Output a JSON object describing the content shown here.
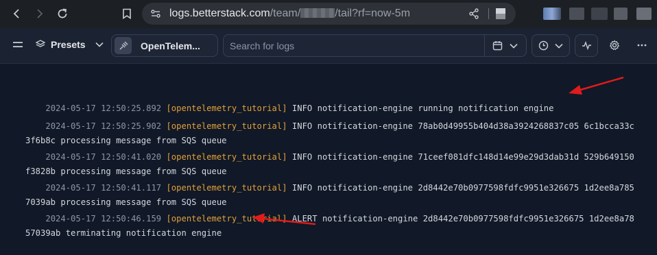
{
  "browser": {
    "url_host": "logs.betterstack.com",
    "url_path_prefix": "/team/",
    "url_path_suffix": "/tail?rf=now-5m"
  },
  "toolbar": {
    "presets_label": "Presets",
    "source_label": "OpenTelem...",
    "search_placeholder": "Search for logs"
  },
  "logs": [
    {
      "timestamp": "2024-05-17 12:50:25.892",
      "source": "[opentelemetry_tutorial]",
      "message": "INFO notification-engine running notification engine"
    },
    {
      "timestamp": "2024-05-17 12:50:25.902",
      "source": "[opentelemetry_tutorial]",
      "message": "INFO notification-engine 78ab0d49955b404d38a3924268837c05 6c1bcca33c3f6b8c processing message from SQS queue"
    },
    {
      "timestamp": "2024-05-17 12:50:41.020",
      "source": "[opentelemetry_tutorial]",
      "message": "INFO notification-engine 71ceef081dfc148d14e99e29d3dab31d 529b649150f3828b processing message from SQS queue"
    },
    {
      "timestamp": "2024-05-17 12:50:41.117",
      "source": "[opentelemetry_tutorial]",
      "message": "INFO notification-engine 2d8442e70b0977598fdfc9951e326675 1d2ee8a7857039ab processing message from SQS queue"
    },
    {
      "timestamp": "2024-05-17 12:50:46.159",
      "source": "[opentelemetry_tutorial]",
      "message": "ALERT notification-engine 2d8442e70b0977598fdfc9951e326675 1d2ee8a7857039ab terminating notification engine"
    }
  ],
  "colors": {
    "timestamp": "#8e96a3",
    "source": "#e0a13a",
    "message": "#d4d8de",
    "annotation_arrow": "#e01b1b"
  }
}
